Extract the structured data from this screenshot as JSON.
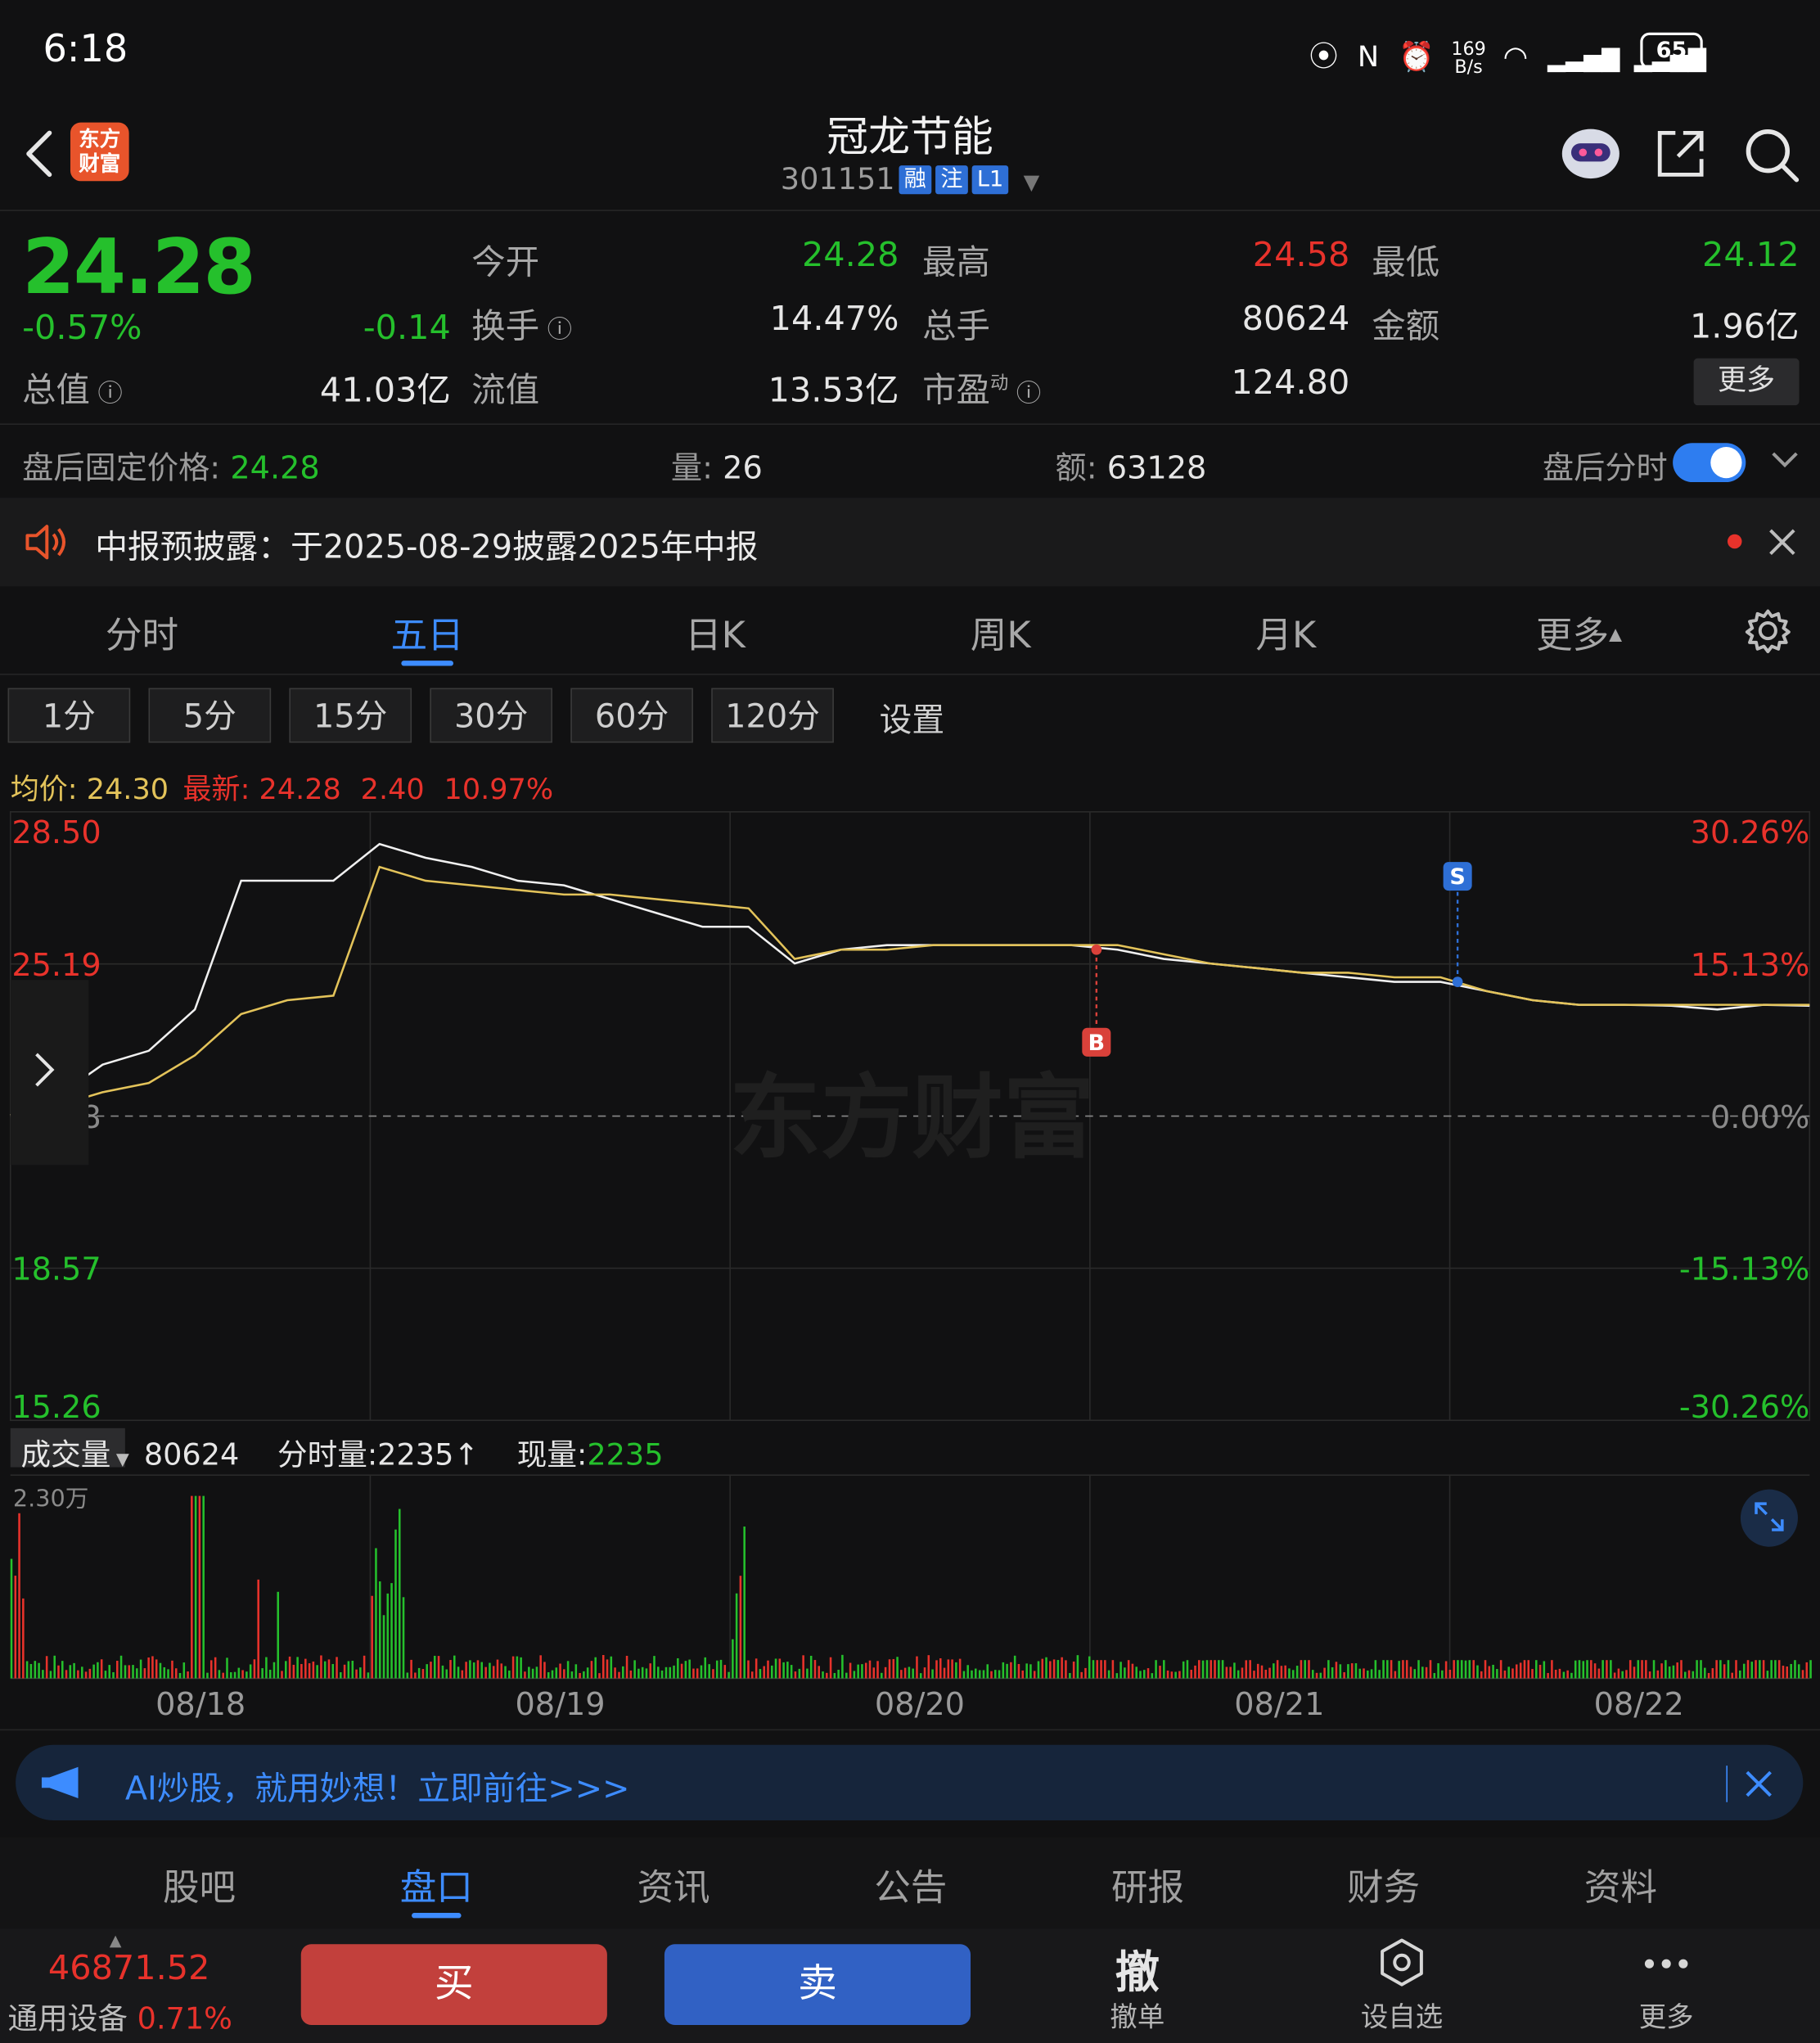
{
  "status_bar": {
    "time": "6:18",
    "net_speed_top": "169",
    "net_speed_bottom": "B/s",
    "battery": "65"
  },
  "header": {
    "stock_name": "冠龙节能",
    "stock_code": "301151",
    "tags": [
      "融",
      "注",
      "L1"
    ],
    "logo_line1": "东方",
    "logo_line2": "财富"
  },
  "quote": {
    "price": "24.28",
    "change_pct": "-0.57%",
    "change": "-0.14",
    "open_label": "今开",
    "open": "24.28",
    "high_label": "最高",
    "high": "24.58",
    "low_label": "最低",
    "low": "24.12",
    "turnover_label": "换手",
    "turnover": "14.47%",
    "volume_label": "总手",
    "volume": "80624",
    "amount_label": "金额",
    "amount": "1.96亿",
    "total_cap_label": "总值",
    "total_cap": "41.03亿",
    "float_cap_label": "流值",
    "float_cap": "13.53亿",
    "pe_label": "市盈",
    "pe_sup": "动",
    "pe": "124.80",
    "more_label": "更多"
  },
  "after_hours": {
    "price_label": "盘后固定价格:",
    "price": "24.28",
    "vol_label": "量:",
    "vol": "26",
    "amt_label": "额:",
    "amt": "63128",
    "toggle_label": "盘后分时",
    "toggle_on": true
  },
  "notice": {
    "text": "中报预披露：于2025-08-29披露2025年中报"
  },
  "main_tabs": {
    "items": [
      "分时",
      "五日",
      "日K",
      "周K",
      "月K",
      "更多"
    ],
    "active": "五日"
  },
  "intervals": {
    "items": [
      "1分",
      "5分",
      "15分",
      "30分",
      "60分",
      "120分"
    ],
    "settings": "设置"
  },
  "avg_line": {
    "avg_label": "均价:",
    "avg": "24.30",
    "latest_label": "最新:",
    "latest": "24.28",
    "change": "2.40",
    "change_pct": "10.97%"
  },
  "chart_data": {
    "type": "line",
    "x_dates": [
      "08/18",
      "08/19",
      "08/20",
      "08/21",
      "08/22"
    ],
    "y_left_ticks": [
      "28.50",
      "25.19",
      "21.88",
      "18.57",
      "15.26"
    ],
    "y_right_ticks": [
      "30.26%",
      "15.13%",
      "0.00%",
      "-15.13%",
      "-30.26%"
    ],
    "ylim": [
      15.26,
      28.5
    ],
    "prev_close": 21.88,
    "series": [
      {
        "name": "最新",
        "values": [
          21.9,
          22.3,
          23.0,
          23.3,
          24.2,
          27.0,
          27.0,
          27.0,
          27.8,
          27.5,
          27.3,
          27.0,
          26.9,
          26.6,
          26.3,
          26.0,
          26.0,
          25.2,
          25.5,
          25.6,
          25.6,
          25.6,
          25.6,
          25.6,
          25.5,
          25.3,
          25.2,
          25.1,
          25.0,
          24.9,
          24.8,
          24.8,
          24.6,
          24.4,
          24.3,
          24.3,
          24.28,
          24.2,
          24.3,
          24.28
        ]
      },
      {
        "name": "均价",
        "values": [
          21.9,
          22.1,
          22.4,
          22.6,
          23.2,
          24.1,
          24.4,
          24.5,
          27.3,
          27.0,
          26.9,
          26.8,
          26.7,
          26.7,
          26.6,
          26.5,
          26.4,
          25.3,
          25.5,
          25.5,
          25.6,
          25.6,
          25.6,
          25.6,
          25.6,
          25.4,
          25.2,
          25.1,
          25.0,
          25.0,
          24.9,
          24.9,
          24.6,
          24.4,
          24.3,
          24.3,
          24.3,
          24.3,
          24.3,
          24.3
        ]
      }
    ],
    "markers": [
      {
        "label": "B",
        "date": "08/20"
      },
      {
        "label": "S",
        "date": "08/21"
      }
    ],
    "watermark": "东方财富"
  },
  "volume": {
    "dropdown_label": "成交量",
    "total": "80624",
    "minute_vol_label": "分时量:",
    "minute_vol": "2235",
    "now_vol_label": "现量:",
    "now_vol": "2235",
    "max_label": "2.30万"
  },
  "ad": {
    "text": "AI炒股，就用妙想！立即前往>>>"
  },
  "bottom_tabs": {
    "items": [
      "股吧",
      "盘口",
      "资讯",
      "公告",
      "研报",
      "财务",
      "资料"
    ],
    "active": "盘口"
  },
  "bottom_bar": {
    "index_value": "46871.52",
    "index_name": "通用设备",
    "index_change": "0.71%",
    "buy": "买",
    "sell": "卖",
    "cancel_icon": "撤",
    "cancel_label": "撤单",
    "watch_label": "设自选",
    "more_label": "更多"
  },
  "colors": {
    "up": "#e8322b",
    "down": "#25c02c",
    "accent": "#3d8cff",
    "price_line": "#ffffff",
    "avg_line": "#e3c35a"
  }
}
